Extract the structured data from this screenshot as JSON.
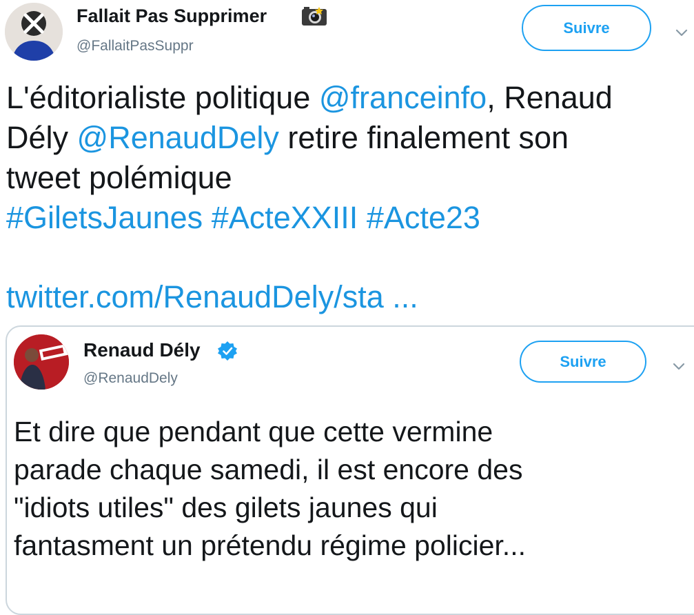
{
  "tweet": {
    "author": {
      "name": "Fallait Pas Supprimer",
      "handle": "@FallaitPasSuppr"
    },
    "follow_label": "Suivre",
    "text_lines": [
      {
        "parts": [
          {
            "text": "L'éditorialiste politique ",
            "type": "text"
          },
          {
            "text": "@franceinfo",
            "type": "mention"
          },
          {
            "text": ", Renaud",
            "type": "text"
          }
        ]
      },
      {
        "parts": [
          {
            "text": "Dély ",
            "type": "text"
          },
          {
            "text": "@RenaudDely",
            "type": "mention"
          },
          {
            "text": " retire finalement son",
            "type": "text"
          }
        ]
      },
      {
        "parts": [
          {
            "text": "tweet polémique",
            "type": "text"
          }
        ]
      },
      {
        "parts": [
          {
            "text": "#GiletsJaunes",
            "type": "hashtag"
          },
          {
            "text": " ",
            "type": "text"
          },
          {
            "text": "#ActeXXIII",
            "type": "hashtag"
          },
          {
            "text": " ",
            "type": "text"
          },
          {
            "text": "#Acte23",
            "type": "hashtag"
          }
        ]
      }
    ],
    "url": "twitter.com/RenaudDely/sta ..."
  },
  "quoted_tweet": {
    "author": {
      "name": "Renaud Dély",
      "handle": "@RenaudDely",
      "verified": true
    },
    "follow_label": "Suivre",
    "text_lines": [
      "Et dire que pendant que cette vermine",
      "parade chaque samedi, il est encore des",
      "\"idiots utiles\" des gilets jaunes qui",
      "fantasment un prétendu régime policier..."
    ]
  },
  "icons": {
    "outer_avatar": "avatar-icon",
    "camera": "camera-icon",
    "chevron": "chevron-down-icon",
    "verified": "verified-badge-icon"
  },
  "colors": {
    "accent": "#1da1f2",
    "link": "#1b95e0",
    "text": "#14171a",
    "secondary": "#657786",
    "border": "#ccd6dd"
  }
}
